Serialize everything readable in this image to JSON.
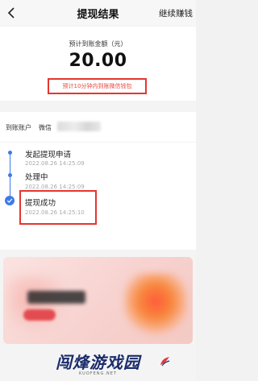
{
  "header": {
    "title": "提现结果",
    "action_label": "继续赚钱",
    "back_icon": "chevron-left-icon"
  },
  "amount": {
    "label": "预计到账金额（元）",
    "value": "20.00",
    "arrival_note": "预计10分钟内到账微信钱包"
  },
  "account": {
    "label": "到账账户",
    "type": "微信"
  },
  "timeline": {
    "steps": [
      {
        "title": "发起提现申请",
        "time": "2022.08.26 14:25:09"
      },
      {
        "title": "处理中",
        "time": "2022.08.26 14:25:09"
      },
      {
        "title": "提现成功",
        "time": "2022.08.26 14:25:10"
      }
    ]
  },
  "colors": {
    "accent": "#3c7be8",
    "highlight": "#e5362f",
    "promo_button": "#e24b50"
  },
  "watermark": {
    "text": "闯烽游戏园",
    "sub": "KUOFENG.NET"
  }
}
